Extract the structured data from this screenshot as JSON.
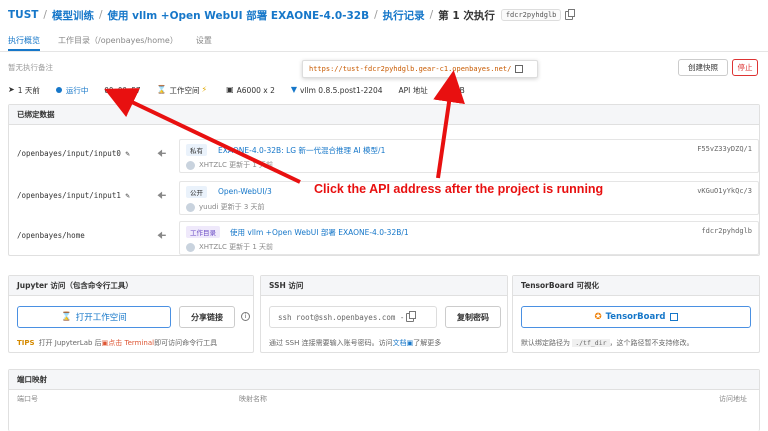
{
  "breadcrumb": {
    "org": "TUST",
    "sep": "/",
    "section": "模型训练",
    "project": "使用 vllm +Open WebUI 部署 EXAONE-4.0-32B",
    "records": "执行记录",
    "current": "第 1 次执行",
    "exec_code": "fdcr2pyhdglb"
  },
  "tabs": [
    {
      "label": "执行概览",
      "active": true
    },
    {
      "label": "工作目录（/openbayes/home）",
      "active": false
    },
    {
      "label": "设置",
      "active": false
    }
  ],
  "remark": "暂无执行备注",
  "api_url": "https://tust-fdcr2pyhdglb.gear-c1.openbayes.net/",
  "actions": {
    "snapshot": "创建快照",
    "stop": "停止"
  },
  "status": {
    "created": "1 天前",
    "state": "运行中",
    "duration": "00:00:57",
    "workspace": "工作空间",
    "gpu": "A6000 x 2",
    "image": "vllm 0.8.5.post1-2204",
    "api_label": "API 地址",
    "storage": "GB"
  },
  "mounts": {
    "title": "已绑定数据",
    "rows": [
      {
        "path": "/openbayes/input/input0",
        "tag": "私有",
        "name": "EXAONE-4.0-32B: LG 新一代混合推理 AI 模型/1",
        "hash": "F55vZ33yDZQ/1",
        "user": "XHTZLC",
        "updated": "更新于 1 天前"
      },
      {
        "path": "/openbayes/input/input1",
        "tag": "公开",
        "name": "Open-WebUI/3",
        "hash": "vKGuO1yYkQc/3",
        "user": "yuudi",
        "updated": "更新于 3 天前"
      },
      {
        "path": "/openbayes/home",
        "tag": "工作目录",
        "name": "使用 vllm +Open WebUI 部署 EXAONE-4.0-32B/1",
        "hash": "fdcr2pyhdglb",
        "user": "XHTZLC",
        "updated": "更新于 1 天前"
      }
    ]
  },
  "jupyter": {
    "title": "Jupyter 访问（包含命令行工具）",
    "open_button": "打开工作空间",
    "share_button": "分享链接",
    "tips_label": "TIPS",
    "tips_a": "打开 JupyterLab 后",
    "tips_b": "点击 Terminal",
    "tips_c": "即可访问命令行工具"
  },
  "ssh": {
    "title": "SSH 访问",
    "command": "ssh root@ssh.openbayes.com -",
    "copy_button": "复制密码",
    "note_a": "通过 SSH 连接需要输入账号密码。访问",
    "note_link": "文档",
    "note_b": "了解更多"
  },
  "tensorboard": {
    "title": "TensorBoard 可视化",
    "button": "TensorBoard",
    "note_a": "默认绑定路径为",
    "note_path": "./tf_dir",
    "note_b": "，这个路径暂不支持修改。"
  },
  "ports": {
    "title": "端口映射",
    "col_port": "端口号",
    "col_name": "映射名称",
    "col_url": "访问地址"
  },
  "annotation": "Click the API address after the project is running",
  "colors": {
    "accent": "#1677c9",
    "annotation": "#e81010",
    "danger": "#dd3333"
  }
}
